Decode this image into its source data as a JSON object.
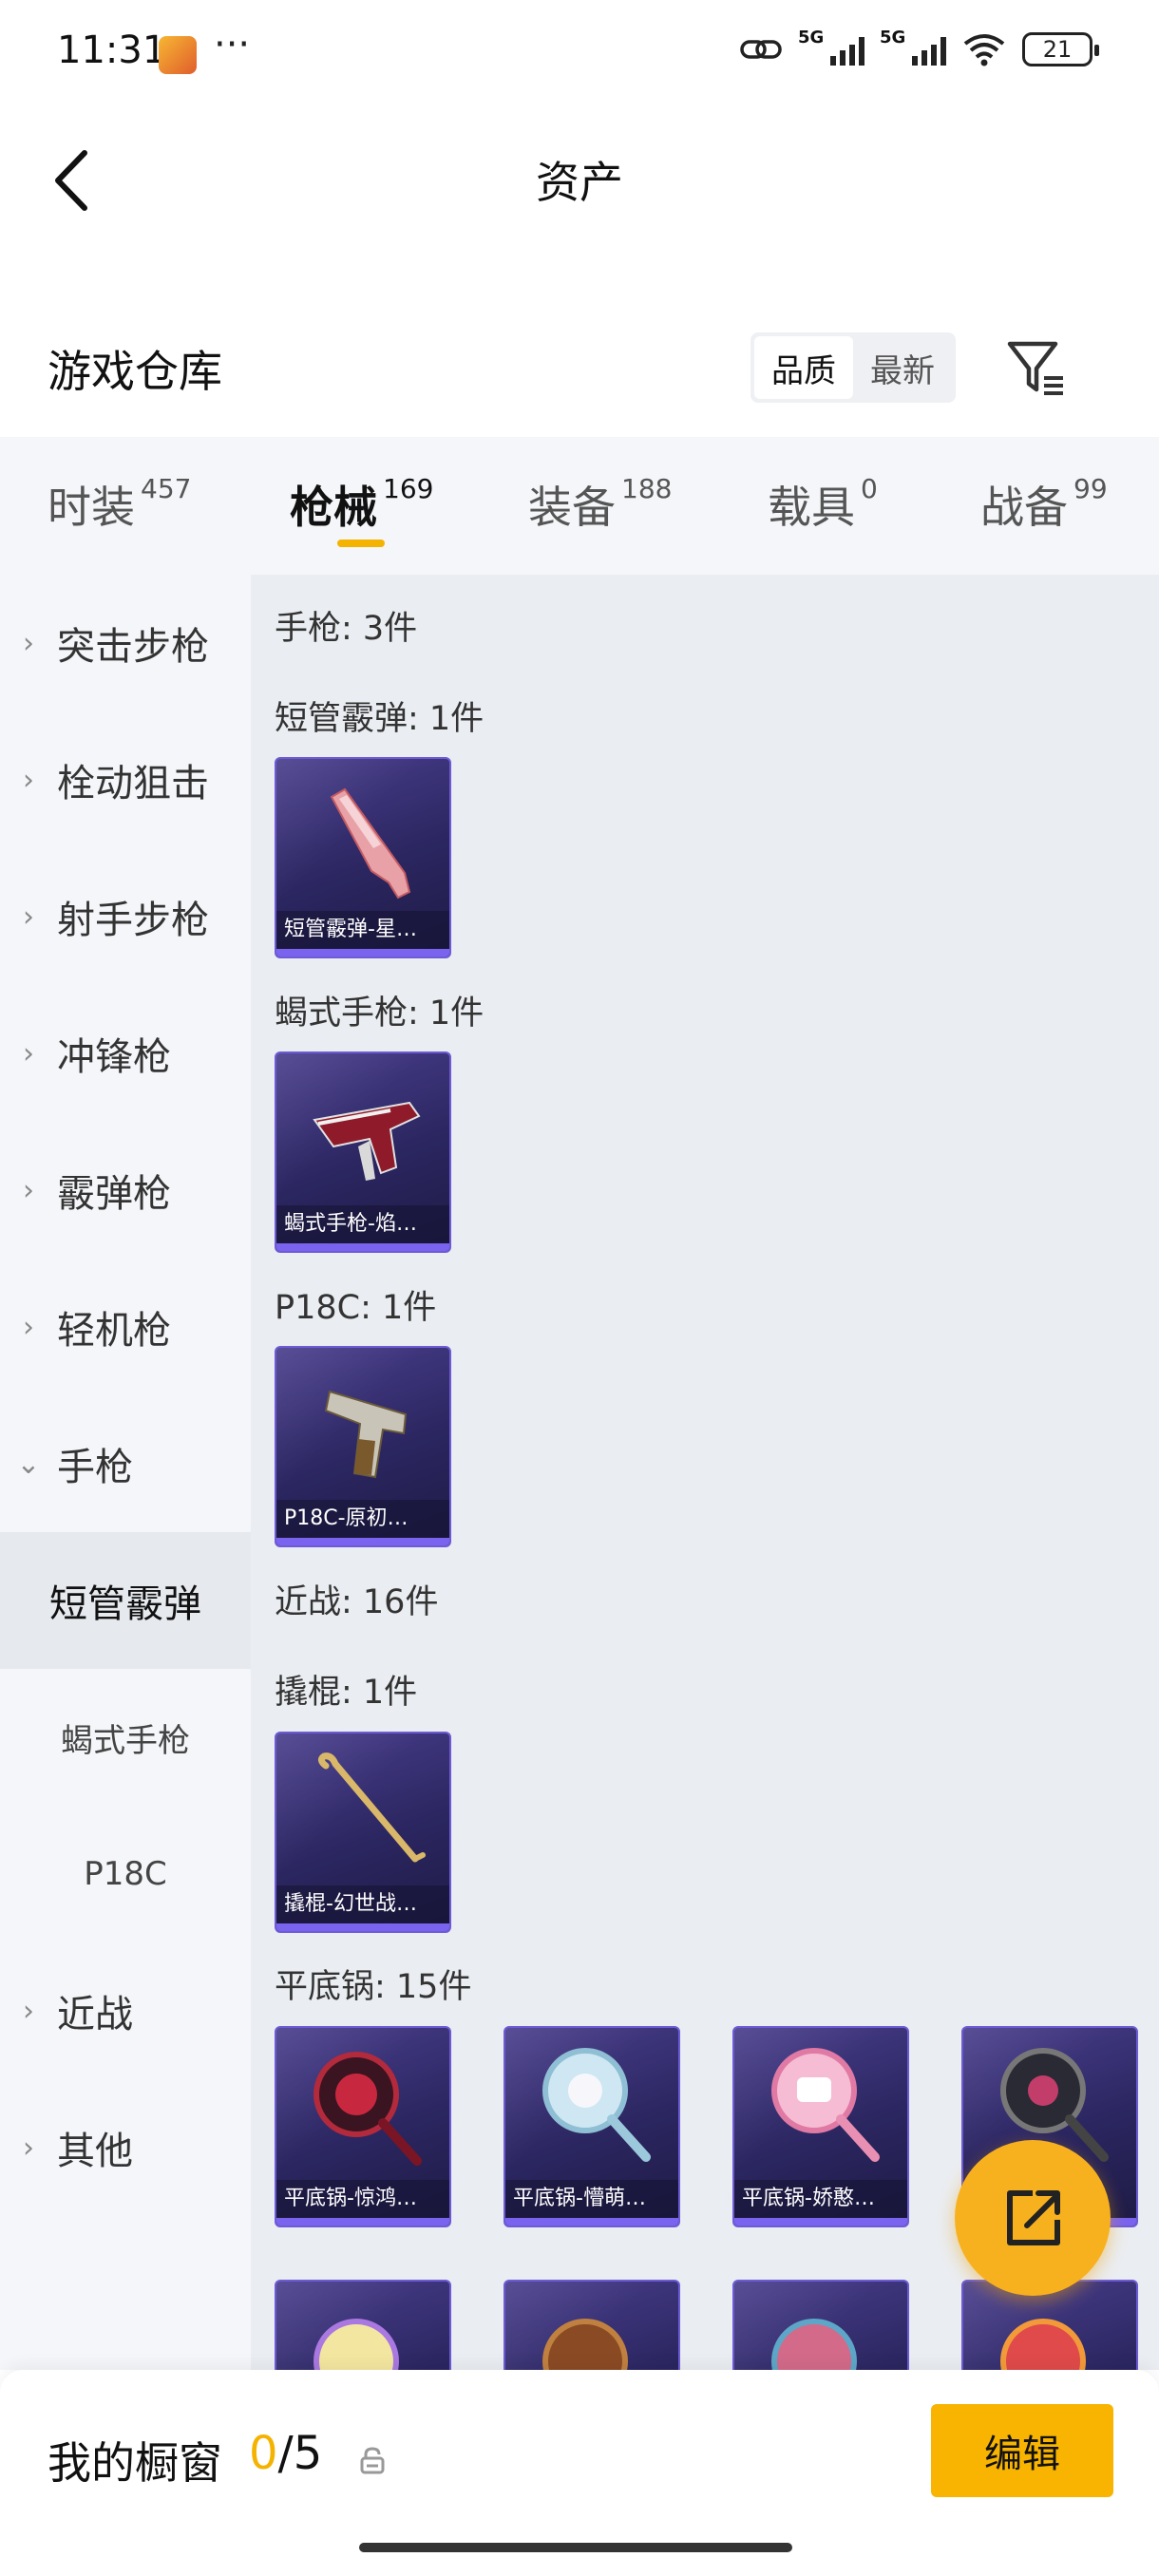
{
  "status": {
    "time": "11:31",
    "more": "···",
    "net1": "5G",
    "net2": "5G",
    "battery": "21"
  },
  "header": {
    "title": "资产"
  },
  "warehouse": {
    "title": "游戏仓库",
    "sort_quality": "品质",
    "sort_newest": "最新"
  },
  "tabs": [
    {
      "label": "时装",
      "count": "457"
    },
    {
      "label": "枪械",
      "count": "169"
    },
    {
      "label": "装备",
      "count": "188"
    },
    {
      "label": "载具",
      "count": "0"
    },
    {
      "label": "战备",
      "count": "99"
    }
  ],
  "sidebar": {
    "items": [
      {
        "label": "突击步枪",
        "chevron": "›"
      },
      {
        "label": "栓动狙击",
        "chevron": "›"
      },
      {
        "label": "射手步枪",
        "chevron": "›"
      },
      {
        "label": "冲锋枪",
        "chevron": "›"
      },
      {
        "label": "霰弹枪",
        "chevron": "›"
      },
      {
        "label": "轻机枪",
        "chevron": "›"
      },
      {
        "label": "手枪",
        "chevron": "⌄"
      },
      {
        "label": "近战",
        "chevron": "›"
      },
      {
        "label": "其他",
        "chevron": "›"
      }
    ],
    "subitems": [
      "短管霰弹",
      "蝎式手枪",
      "P18C"
    ]
  },
  "content": {
    "labels": {
      "pistol": "手枪: 3件",
      "sawed_off": "短管霰弹: 1件",
      "scorpion": "蝎式手枪: 1件",
      "p18c": "P18C: 1件",
      "melee": "近战: 16件",
      "crowbar": "撬棍: 1件",
      "pan": "平底锅: 15件"
    },
    "cards": {
      "sawed_off": "短管霰弹-星…",
      "scorpion": "蝎式手枪-焰…",
      "p18c": "P18C-原初…",
      "crowbar": "撬棍-幻世战…",
      "pan1": "平底锅-惊鸿…",
      "pan2": "平底锅-懵萌…",
      "pan3": "平底锅-娇憨…"
    }
  },
  "bottom": {
    "title": "我的橱窗",
    "current": "0",
    "total": "/5",
    "edit_label": "编辑"
  },
  "icons": {
    "back": "back-arrow-icon",
    "filter": "filter-icon",
    "share": "share-icon",
    "lock": "lock-icon"
  },
  "colors": {
    "accent": "#f5b301",
    "card_border": "#6d5bd6",
    "card_bg": "#2b2660"
  }
}
